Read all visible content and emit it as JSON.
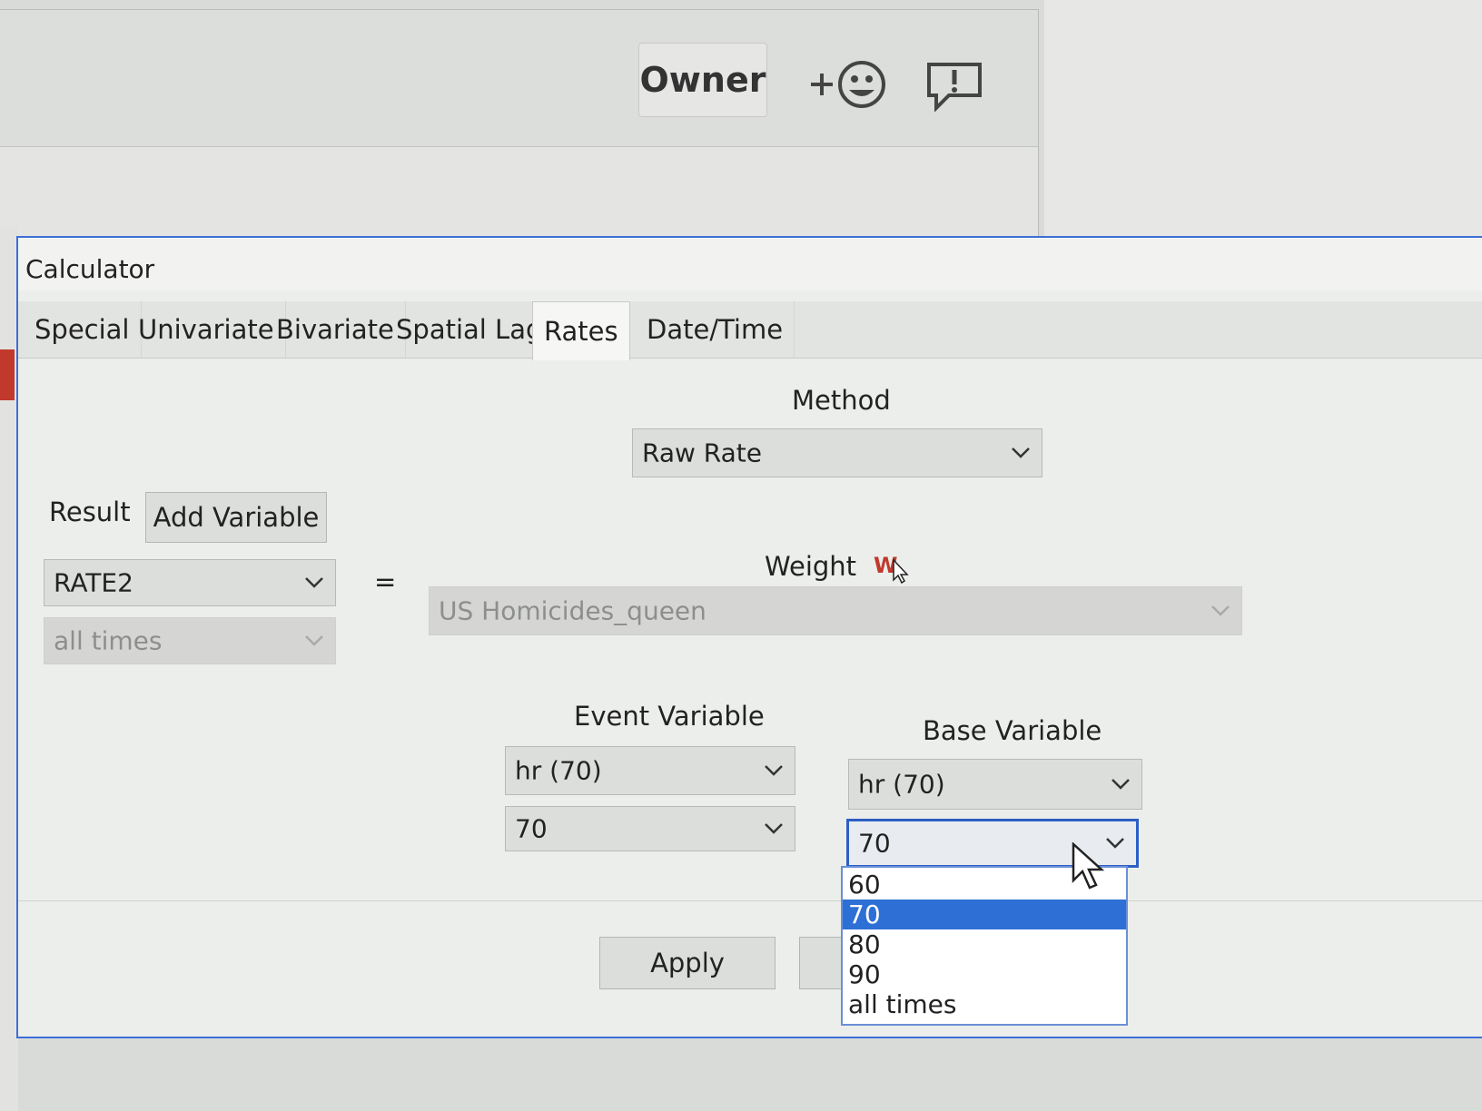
{
  "background_app": {
    "owner_label": "Owner",
    "add_emoji_icon": "add-emoji-icon",
    "feedback_icon": "feedback-icon"
  },
  "dialog": {
    "title": "Calculator",
    "tabs": [
      {
        "label": "Special"
      },
      {
        "label": "Univariate"
      },
      {
        "label": "Bivariate"
      },
      {
        "label": "Spatial Lag"
      },
      {
        "label": "Rates",
        "active": true
      },
      {
        "label": "Date/Time"
      }
    ],
    "method": {
      "label": "Method",
      "value": "Raw Rate"
    },
    "result": {
      "label": "Result",
      "add_variable_label": "Add Variable",
      "variable_value": "RATE2",
      "time_value": "all times"
    },
    "equals_sign": "=",
    "weight": {
      "label": "Weight",
      "value": "US Homicides_queen"
    },
    "event_variable": {
      "label": "Event Variable",
      "variable_value": "hr (70)",
      "time_value": "70"
    },
    "base_variable": {
      "label": "Base Variable",
      "variable_value": "hr (70)",
      "time_value": "70",
      "dropdown_options": [
        "60",
        "70",
        "80",
        "90",
        "all times"
      ],
      "selected_option": "70"
    },
    "apply_label": "Apply"
  },
  "colors": {
    "accent": "#2e6fd6",
    "dialog_border": "#3c6fd8",
    "weight_icon": "#c0392b"
  }
}
